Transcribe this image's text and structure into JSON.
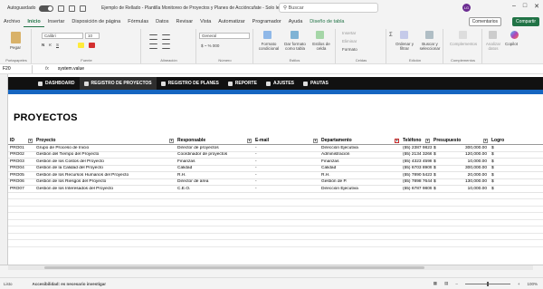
{
  "titlebar": {
    "autosave_label": "Autoguardado",
    "title": "Ejemplo de Rellado - Plantilla Monitoreo de Proyectos y Planes de Accióncufate - Solo lec...",
    "search_placeholder": "Buscar",
    "avatar_initials": "LG"
  },
  "menubar": {
    "tabs": [
      "Archivo",
      "Inicio",
      "Insertar",
      "Disposición de página",
      "Fórmulas",
      "Datos",
      "Revisar",
      "Vista",
      "Automatizar",
      "Programador",
      "Ayuda",
      "Diseño de tabla"
    ],
    "comments_label": "Comentarios",
    "share_label": "Compartir"
  },
  "ribbon": {
    "paste_label": "Pegar",
    "font_name": "Calibri",
    "font_size": "10",
    "number_format": "General",
    "cond_format": "Formato condicional",
    "format_table": "Dar formato como tabla",
    "cell_styles": "Estilos de celda",
    "insert": "Insertar",
    "delete": "Eliminar",
    "format": "Formato",
    "sort_filter": "Ordenar y filtrar",
    "find_select": "Buscar y seleccionar",
    "addins": "Complementos",
    "analyze": "Analizar datos",
    "copilot": "Copilot",
    "groups": [
      "Portapapeles",
      "Fuente",
      "Alineación",
      "Número",
      "Estilos",
      "Celdas",
      "Edición",
      "Complementos"
    ]
  },
  "formulabar": {
    "namebox": "F20",
    "fx": "fx",
    "value": "system.value"
  },
  "nav": [
    {
      "label": "DASHBOARD"
    },
    {
      "label": "REGISTRO DE PROYECTOS"
    },
    {
      "label": "REGISTRO DE PLANES"
    },
    {
      "label": "REPORTE"
    },
    {
      "label": "AJUSTES"
    },
    {
      "label": "PAUTAS"
    }
  ],
  "heading": "PROYECTOS",
  "table": {
    "columns": [
      "ID",
      "Proyecto",
      "Responsable",
      "E-mail",
      "Departamento",
      "Teléfono",
      "Presupuesto",
      "Logro"
    ],
    "rows": [
      [
        "PRO01",
        "Grupo de Proceso de Inicio",
        "Director de proyectos",
        "-",
        "Dirección Ejecutiva",
        "(55) 2387 9823",
        "$",
        "300,000.00",
        "$"
      ],
      [
        "PRO02",
        "Gestión del Tiempo del Proyecto",
        "Coordinador de proyectos",
        "-",
        "Administración",
        "(55) 2134 3266",
        "$",
        "120,000.00",
        "$"
      ],
      [
        "PRO03",
        "Gestión de los Costos del Proyecto",
        "Finanzas",
        "-",
        "Finanzas",
        "(55) 4323 4598",
        "$",
        "10,000.00",
        "$"
      ],
      [
        "PRO04",
        "Gestión de la Calidad del Proyecto",
        "Calidad",
        "-",
        "Calidad",
        "(55) 6703 8909",
        "$",
        "300,000.00",
        "$"
      ],
      [
        "PRO05",
        "Gestión de los Recursos Humanos del Proyecto",
        "R.H.",
        "-",
        "R.H.",
        "(55) 7890 5423",
        "$",
        "20,000.00",
        "$"
      ],
      [
        "PRO06",
        "Gestión de los Riesgos del Proyecto",
        "Director de área",
        "-",
        "Gestión de P.",
        "(55) 7898 7644",
        "$",
        "130,000.00",
        "$"
      ],
      [
        "PRO07",
        "Gestión de los Interesados del Proyecto",
        "C.E.O.",
        "-",
        "Dirección Ejecutiva",
        "(55) 6787 9809",
        "$",
        "10,000.00",
        "$"
      ]
    ]
  },
  "status": {
    "ready": "Listo",
    "accessibility": "Accesibilidad: es necesario investigar",
    "zoom": "100%"
  },
  "colors": {
    "accent": "#217346",
    "nav_bg": "#111111",
    "band": "#1565c0"
  }
}
